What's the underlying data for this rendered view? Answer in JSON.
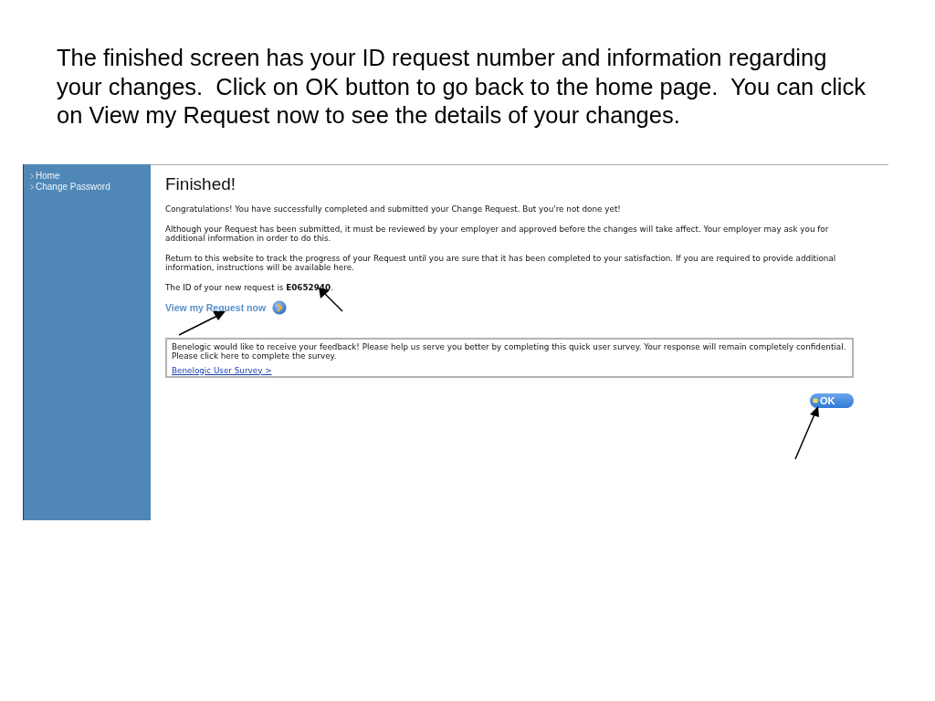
{
  "caption": "The finished screen has your ID request number and information regarding your changes.  Click on OK button to go back to the home page.  You can click on View my Request now to see the details of your changes.",
  "sidebar": {
    "items": [
      {
        "label": "Home"
      },
      {
        "label": "Change Password"
      }
    ]
  },
  "content": {
    "title": "Finished!",
    "paragraphs": [
      "Congratulations! You have successfully completed and submitted your Change Request. But you're not done yet!",
      "Although your Request has been submitted, it must be reviewed by your employer and approved before the changes will take affect. Your employer may ask you for additional information in order to do this.",
      "Return to this website to track the progress of your Request until you are sure that it has been completed to your satisfaction. If you are required to provide additional information, instructions will be available here.",
      "The ID of your new request is **E0652940**."
    ],
    "view_link": {
      "label": "View my Request now"
    },
    "survey": {
      "message": "Benelogic would like to receive your feedback! Please help us serve you better by completing this quick user survey. Your response will remain completely confidential.\nPlease click here to complete the survey.",
      "link": "Benelogic User Survey >"
    },
    "ok_button": {
      "label": "OK"
    }
  }
}
